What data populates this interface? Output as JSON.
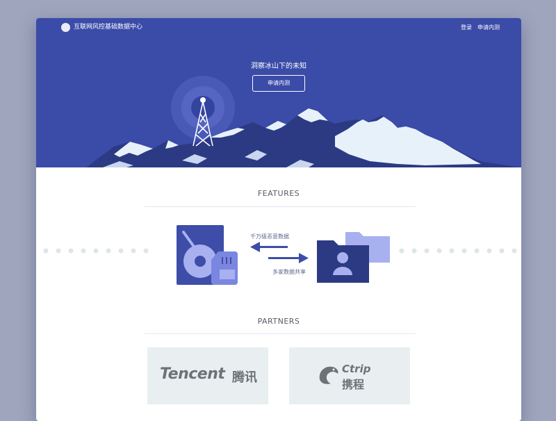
{
  "header": {
    "title": "互联网风控基础数据中心",
    "login_label": "登录",
    "apply_label": "申请内测"
  },
  "hero": {
    "slogan": "洞察冰山下的未知",
    "cta_label": "申请内测"
  },
  "features": {
    "title": "FEATURES",
    "arrow_left_label": "千万级恶意数据",
    "arrow_right_label": "多家数据共享"
  },
  "partners": {
    "title": "PARTNERS",
    "items": [
      {
        "name": "Tencent",
        "name_cn": "腾讯"
      },
      {
        "name": "Ctrip",
        "name_cn": "携程"
      }
    ]
  },
  "colors": {
    "hero_bg": "#3b4ba8",
    "mountain": "#2c3a84",
    "snow": "#e7f1fa",
    "accent": "#9da6ef"
  }
}
